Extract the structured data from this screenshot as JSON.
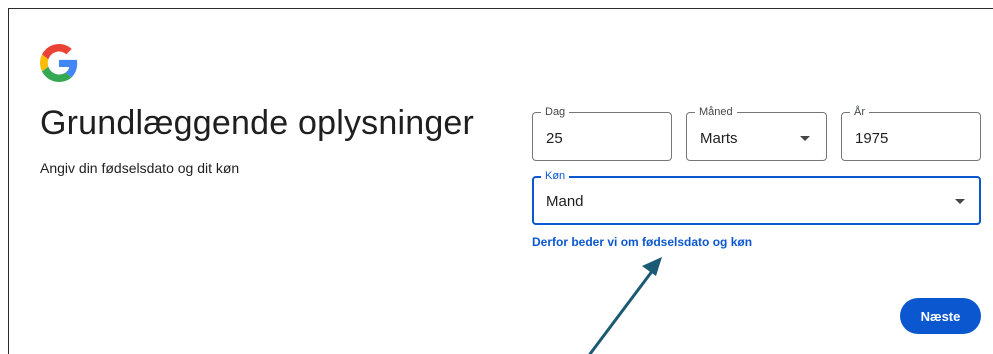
{
  "page": {
    "title": "Grundlæggende oplysninger",
    "subtitle": "Angiv din fødselsdato og dit køn"
  },
  "logo": {
    "icon": "google-g-icon"
  },
  "form": {
    "day": {
      "label": "Dag",
      "value": "25"
    },
    "month": {
      "label": "Måned",
      "value": "Marts"
    },
    "year": {
      "label": "År",
      "value": "1975"
    },
    "gender": {
      "label": "Køn",
      "value": "Mand"
    }
  },
  "why_link": "Derfor beder vi om fødselsdato og køn",
  "next_button": "Næste",
  "colors": {
    "accent": "#0b57d0",
    "annotation_arrow": "#1b5a73",
    "text": "#1f1f1f",
    "border": "#747775"
  }
}
